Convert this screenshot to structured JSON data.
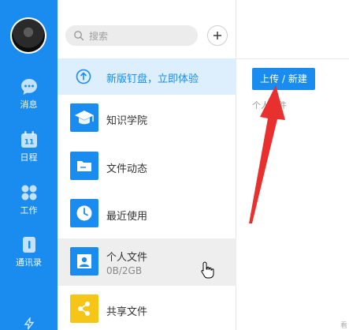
{
  "rail": {
    "items": [
      {
        "label": "消息",
        "icon": "chat-bubble-icon"
      },
      {
        "label": "日程",
        "icon": "calendar-icon",
        "badge": "11"
      },
      {
        "label": "工作",
        "icon": "apps-grid-icon"
      },
      {
        "label": "通讯录",
        "icon": "contacts-icon"
      }
    ],
    "bottom_icon": "lightning-icon"
  },
  "search": {
    "placeholder": "搜索"
  },
  "promo": {
    "label": "新版钉盘，立即体验"
  },
  "list": [
    {
      "label": "知识学院",
      "icon": "graduation-cap-icon"
    },
    {
      "label": "文件动态",
      "icon": "folder-icon"
    },
    {
      "label": "最近使用",
      "icon": "clock-icon"
    },
    {
      "label": "个人文件",
      "sub": "0B/2GB",
      "icon": "person-icon",
      "active": true
    },
    {
      "label": "共享文件",
      "icon": "share-icon"
    }
  ],
  "content": {
    "upload_label": "上传 / 新建",
    "breadcrumb": "个人文件",
    "corner_mark": "看"
  },
  "colors": {
    "accent": "#1a8cf0",
    "promo_bg": "#ddeefd",
    "share_tile": "#f5c518",
    "annotation_arrow": "#e8302e"
  }
}
